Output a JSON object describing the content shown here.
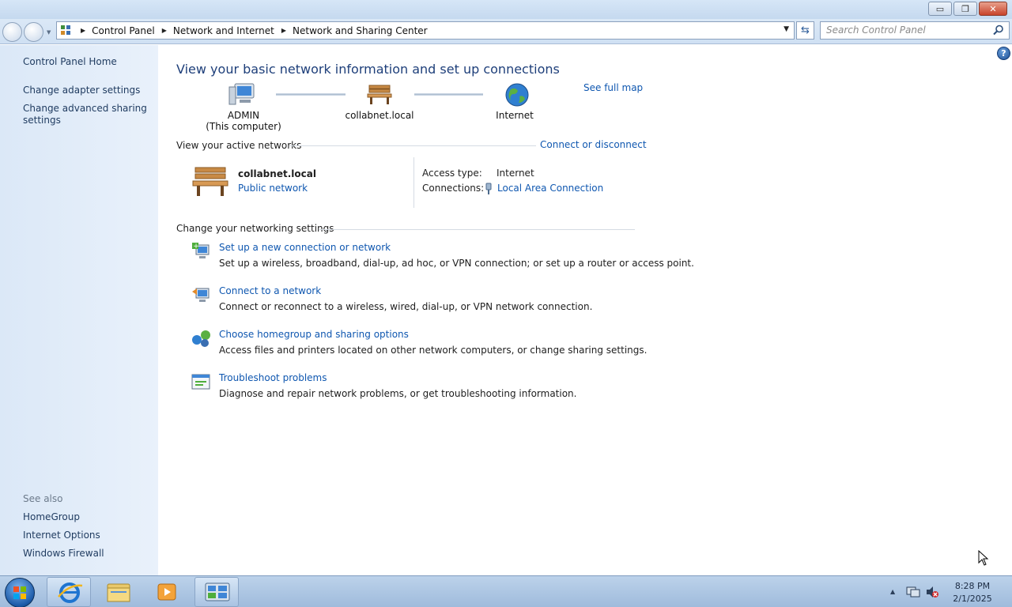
{
  "window": {
    "controls": {
      "minimize": "▭",
      "maximize": "❐",
      "close": "✕"
    }
  },
  "address_bar": {
    "breadcrumbs": [
      "Control Panel",
      "Network and Internet",
      "Network and Sharing Center"
    ],
    "search_placeholder": "Search Control Panel"
  },
  "left_pane": {
    "links": [
      "Control Panel Home",
      "Change adapter settings",
      "Change advanced sharing",
      "settings"
    ],
    "see_also_label": "See also",
    "see_also": [
      "HomeGroup",
      "Internet Options",
      "Windows Firewall"
    ]
  },
  "main": {
    "title": "View your basic network information and set up connections",
    "see_full_map": "See full map",
    "map": {
      "computer_name": "ADMIN",
      "computer_sub": "(This computer)",
      "network_name": "collabnet.local",
      "internet": "Internet"
    },
    "active_networks": {
      "heading": "View your active networks",
      "connect_link": "Connect or disconnect",
      "network_name": "collabnet.local",
      "network_type": "Public network",
      "access_type_label": "Access type:",
      "access_type_value": "Internet",
      "connections_label": "Connections:",
      "connections_value": "Local Area Connection"
    },
    "settings_heading": "Change your networking settings",
    "tasks": [
      {
        "title": "Set up a new connection or network",
        "desc": "Set up a wireless, broadband, dial-up, ad hoc, or VPN connection; or set up a router or access point."
      },
      {
        "title": "Connect to a network",
        "desc": "Connect or reconnect to a wireless, wired, dial-up, or VPN network connection."
      },
      {
        "title": "Choose homegroup and sharing options",
        "desc": "Access files and printers located on other network computers, or change sharing settings."
      },
      {
        "title": "Troubleshoot problems",
        "desc": "Diagnose and repair network problems, or get troubleshooting information."
      }
    ]
  },
  "taskbar": {
    "time": "8:28 PM",
    "date": "2/1/2025"
  },
  "colors": {
    "link": "#0f57b0",
    "title": "#1e3f7a",
    "left_pane": "#dbe8f7"
  }
}
